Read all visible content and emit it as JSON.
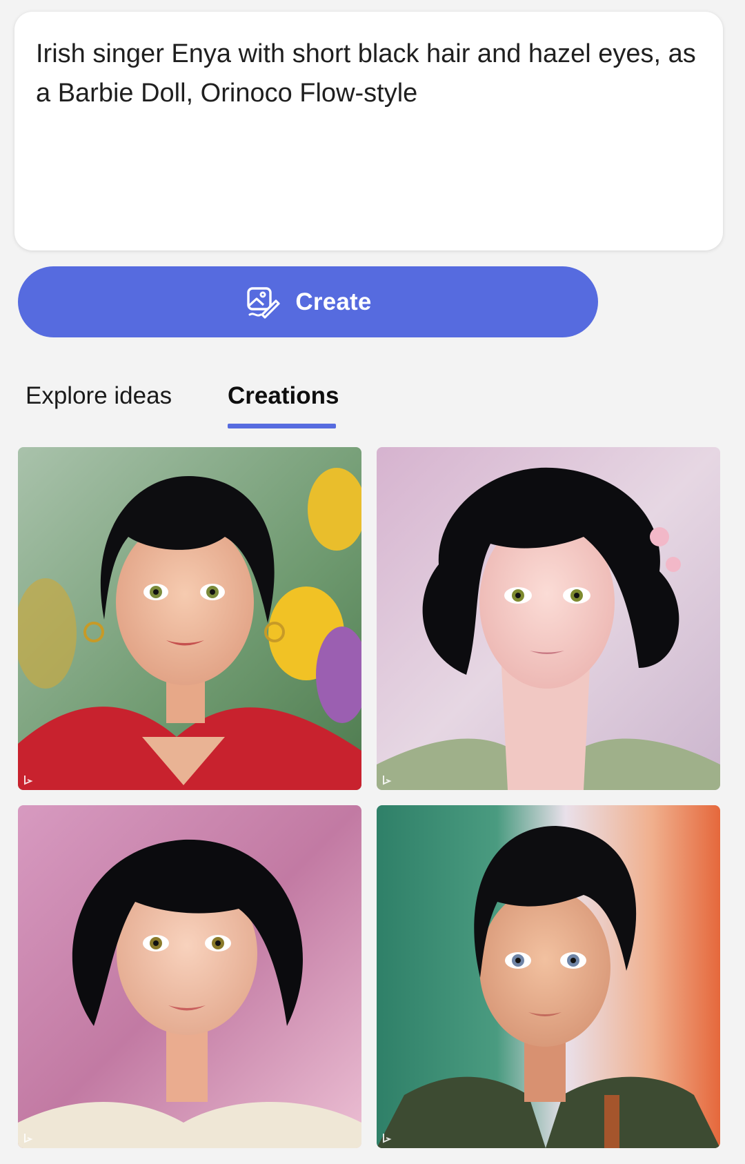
{
  "prompt": {
    "text": "Irish singer Enya with short black hair and hazel eyes, as a Barbie Doll, Orinoco Flow-style"
  },
  "create_button": {
    "label": "Create",
    "icon": "image-create-icon",
    "color": "#566bdf"
  },
  "tabs": [
    {
      "label": "Explore ideas",
      "active": false
    },
    {
      "label": "Creations",
      "active": true
    }
  ],
  "creations": [
    {
      "alt": "doll with short black bob, red top, flower background",
      "hair": "#0d0d10",
      "top": "#c8222e",
      "bg": [
        "#7fa88a",
        "#e6c24b"
      ]
    },
    {
      "alt": "doll with curly black hair and pink flowers",
      "hair": "#0c0c0f",
      "top": "#9fb08a",
      "bg": [
        "#d8c0d8",
        "#e9dde6"
      ]
    },
    {
      "alt": "doll with black bob, cream top, pink background",
      "hair": "#0b0b0e",
      "top": "#efe7d6",
      "bg": [
        "#c57aa2",
        "#e7b3cb"
      ]
    },
    {
      "alt": "doll with short black hair, green jacket",
      "hair": "#0d0d10",
      "top": "#3d4b32",
      "bg": [
        "#3f8d74",
        "#e6784a"
      ]
    }
  ],
  "watermark_icon": "bing-logo-icon"
}
